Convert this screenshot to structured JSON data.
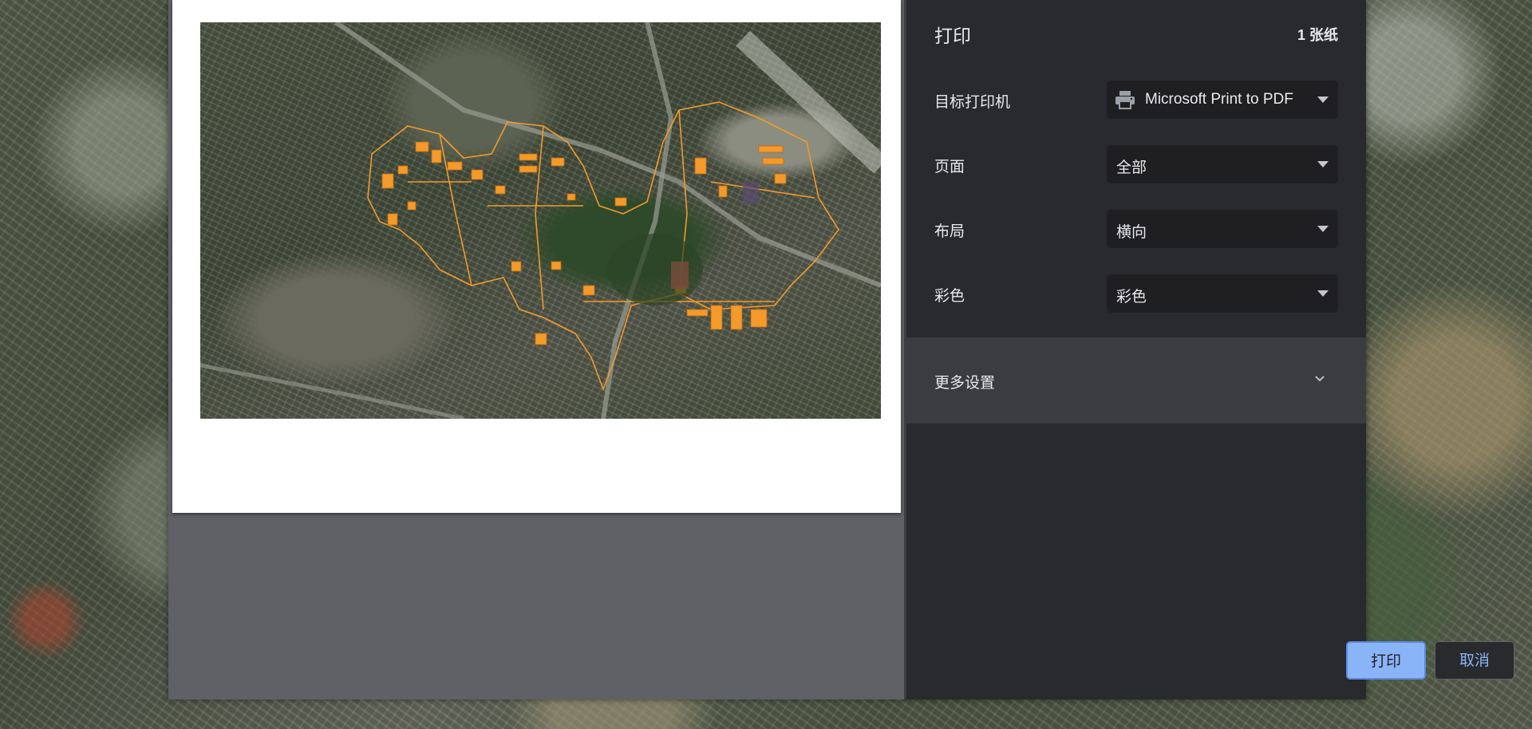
{
  "dialog": {
    "title": "打印",
    "sheet_count": "1 张纸"
  },
  "settings": {
    "destination": {
      "label": "目标打印机",
      "value": "Microsoft Print to PDF",
      "icon": "printer-icon"
    },
    "pages": {
      "label": "页面",
      "value": "全部"
    },
    "layout": {
      "label": "布局",
      "value": "横向"
    },
    "color": {
      "label": "彩色",
      "value": "彩色"
    }
  },
  "more_settings": {
    "label": "更多设置",
    "icon": "chevron-down-icon"
  },
  "buttons": {
    "print": "打印",
    "cancel": "取消"
  },
  "colors": {
    "panel_bg": "#292a2d",
    "accent": "#8ab4f8",
    "map_outline": "#f39a2b"
  }
}
